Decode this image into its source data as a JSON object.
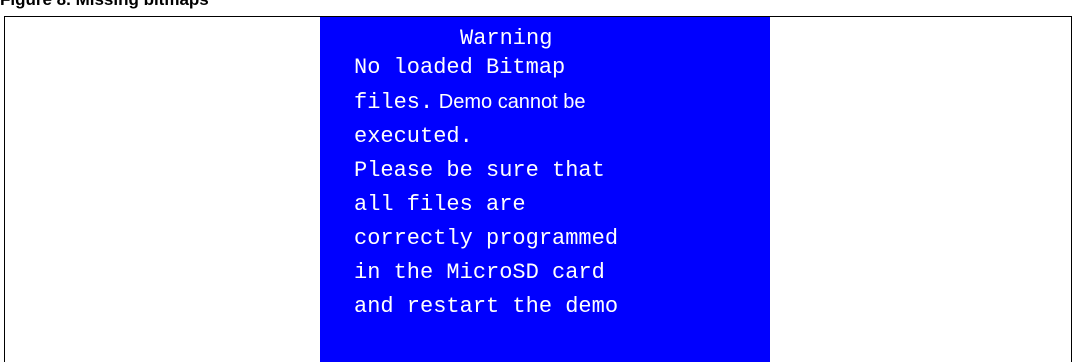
{
  "figure": {
    "caption": "Figure 8. Missing bitmaps"
  },
  "lcd": {
    "background": "#0000ff",
    "text_color": "#ffffff",
    "title": "Warning",
    "lines": [
      "No loaded Bitmap",
      "files.",
      "Demo cannot be",
      "executed.",
      "Please be sure that",
      "all files are",
      "correctly programmed",
      "in the MicroSD card",
      "and restart the demo"
    ]
  }
}
